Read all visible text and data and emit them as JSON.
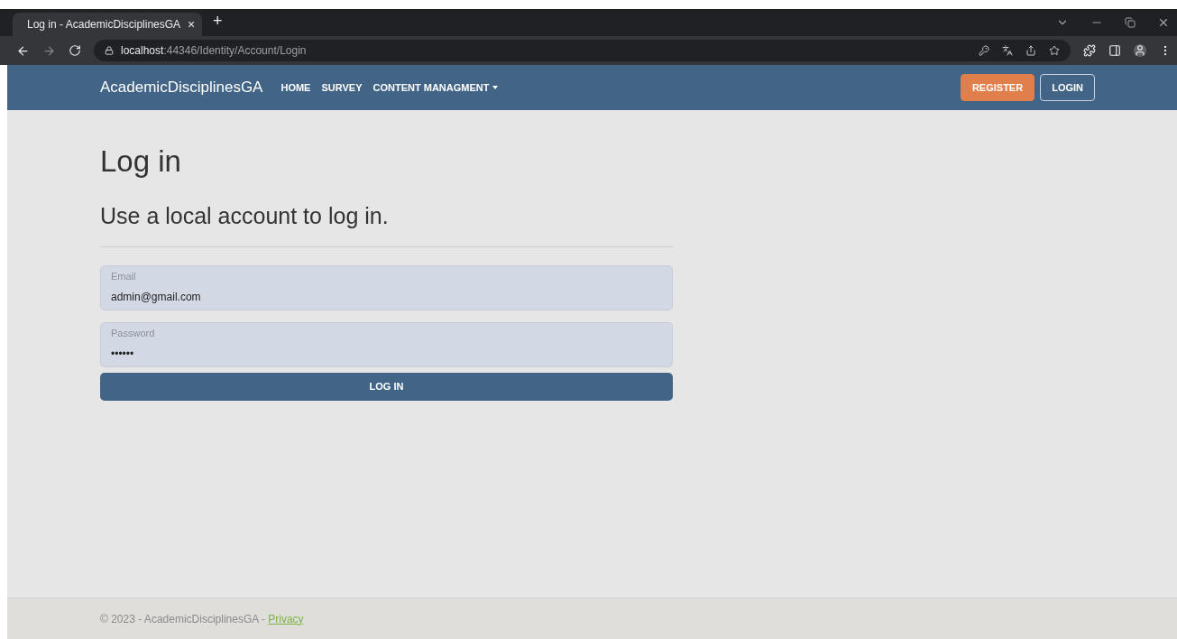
{
  "browser": {
    "tab": {
      "title": "Log in - AcademicDisciplinesGA",
      "close": "×",
      "selected": true
    },
    "new_tab": "+",
    "url_host": "localhost",
    "url_path": ":44346/Identity/Account/Login"
  },
  "navbar": {
    "brand": "AcademicDisciplinesGA",
    "links": [
      {
        "label": "HOME",
        "dropdown": false
      },
      {
        "label": "SURVEY",
        "dropdown": false
      },
      {
        "label": "CONTENT MANAGMENT",
        "dropdown": true
      }
    ],
    "buttons": [
      {
        "label": "REGISTER",
        "kind": "filled"
      },
      {
        "label": "LOGIN",
        "kind": "outline"
      }
    ]
  },
  "page": {
    "title": "Log in",
    "subtitle": "Use a local account to log in.",
    "fields": [
      {
        "label": "Email",
        "value": "admin@gmail.com"
      },
      {
        "label": "Password",
        "value": "••••••"
      }
    ],
    "submit": "LOG IN"
  },
  "footer": {
    "text": "© 2023 - AcademicDisciplinesGA - ",
    "link": "Privacy"
  }
}
